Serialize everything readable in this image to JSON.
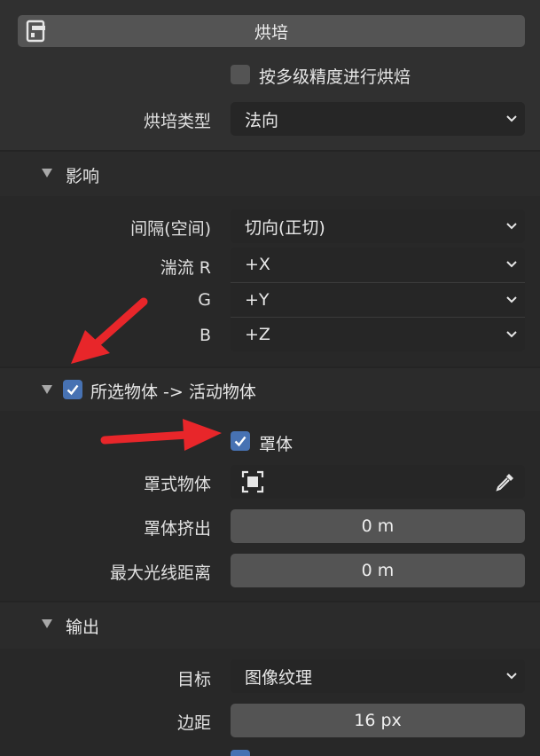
{
  "bake": {
    "button_label": "烘培"
  },
  "multires": {
    "label": "按多级精度进行烘焙",
    "checked": false
  },
  "bake_type": {
    "label": "烘培类型",
    "value": "法向"
  },
  "influence": {
    "title": "影响",
    "space_label": "间隔(空间)",
    "space_value": "切向(正切)",
    "swizzle_r_label": "湍流 R",
    "swizzle_r_value": "+X",
    "swizzle_g_label": "G",
    "swizzle_g_value": "+Y",
    "swizzle_b_label": "B",
    "swizzle_b_value": "+Z"
  },
  "selected_to_active": {
    "title": "所选物体 -> 活动物体",
    "checked": true,
    "cage_label": "罩体",
    "cage_checked": true,
    "cage_object_label": "罩式物体",
    "cage_object_value": "",
    "cage_extrusion_label": "罩体挤出",
    "cage_extrusion_value": "0 m",
    "max_ray_label": "最大光线距离",
    "max_ray_value": "0 m"
  },
  "output": {
    "title": "输出",
    "target_label": "目标",
    "target_value": "图像纹理",
    "margin_label": "边距",
    "margin_value": "16 px"
  },
  "colors": {
    "accent": "#4772b3",
    "arrow": "#e8262a"
  }
}
